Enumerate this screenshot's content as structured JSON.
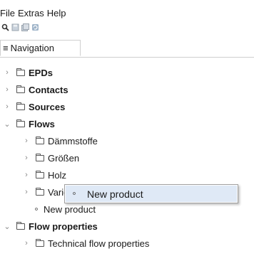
{
  "menubar": {
    "items": [
      "File",
      "Extras",
      "Help"
    ]
  },
  "toolbar": {
    "icons": [
      "search-icon",
      "save-icon",
      "save-all-icon",
      "refresh-icon"
    ]
  },
  "tab": {
    "label": "Navigation"
  },
  "tree": {
    "epds": "EPDs",
    "contacts": "Contacts",
    "sources": "Sources",
    "flows": "Flows",
    "daemmstoffe": "Dämmstoffe",
    "groessen": "Größen",
    "holz": "Holz",
    "various": "Various substances",
    "new_product": "New product",
    "flow_properties": "Flow properties",
    "technical": "Technical flow properties"
  },
  "context_menu": {
    "item": "New product"
  }
}
